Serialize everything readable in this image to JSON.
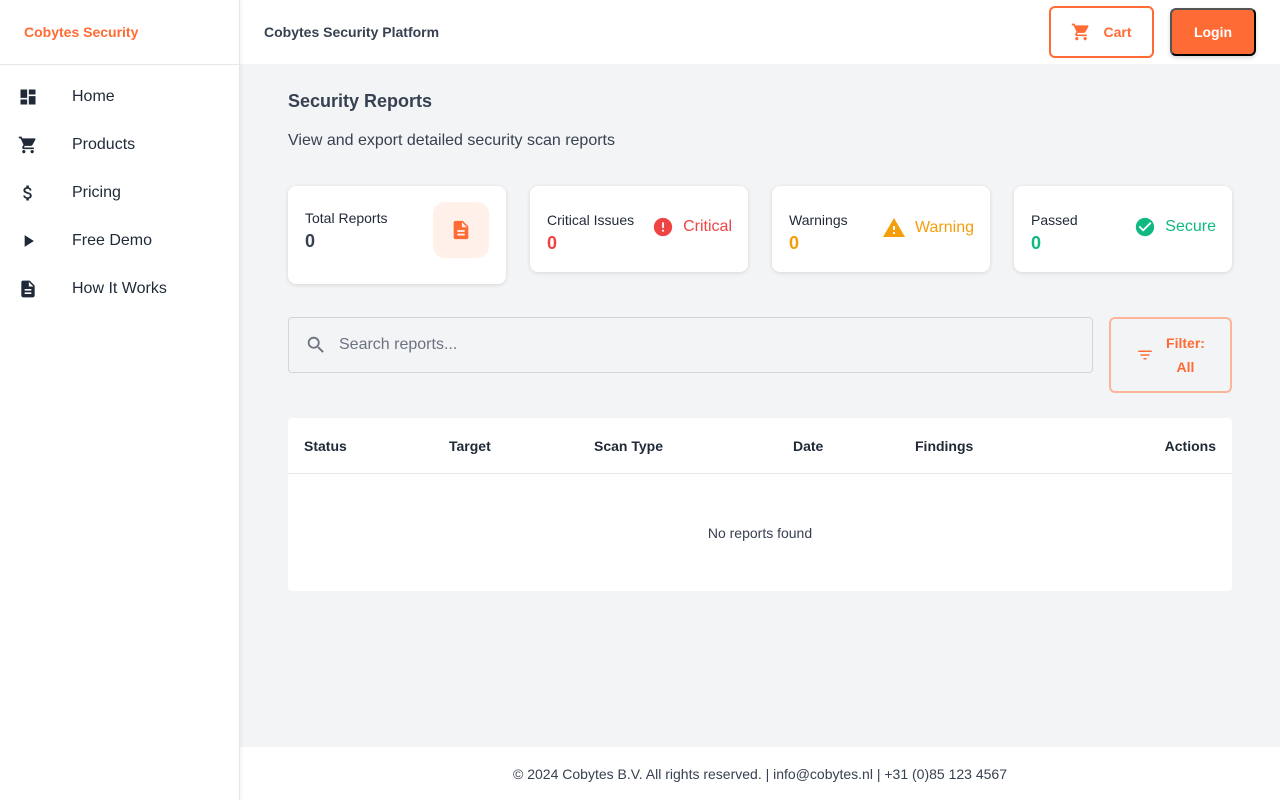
{
  "sidebar": {
    "brand": "Cobytes Security",
    "items": [
      {
        "label": "Home",
        "icon": "dashboard-icon"
      },
      {
        "label": "Products",
        "icon": "cart-icon"
      },
      {
        "label": "Pricing",
        "icon": "dollar-icon"
      },
      {
        "label": "Free Demo",
        "icon": "play-icon"
      },
      {
        "label": "How It Works",
        "icon": "document-icon"
      }
    ]
  },
  "header": {
    "title": "Cobytes Security Platform",
    "cart_label": "Cart",
    "login_label": "Login"
  },
  "main": {
    "title": "Security Reports",
    "subtitle": "View and export detailed security scan reports",
    "stats": [
      {
        "label": "Total Reports",
        "value": "0",
        "icon": "report-document-icon"
      },
      {
        "label": "Critical Issues",
        "value": "0",
        "status": "Critical",
        "icon": "error-icon",
        "color": "#ef4444"
      },
      {
        "label": "Warnings",
        "value": "0",
        "status": "Warning",
        "icon": "warning-icon",
        "color": "#f59e0b"
      },
      {
        "label": "Passed",
        "value": "0",
        "status": "Secure",
        "icon": "check-circle-icon",
        "color": "#10b981"
      }
    ],
    "search": {
      "placeholder": "Search reports...",
      "value": ""
    },
    "filter": {
      "line1": "Filter:",
      "line2": "All"
    },
    "table": {
      "columns": [
        "Status",
        "Target",
        "Scan Type",
        "Date",
        "Findings",
        "Actions"
      ],
      "empty_message": "No reports found"
    }
  },
  "footer": {
    "text": "© 2024 Cobytes B.V. All rights reserved. | info@cobytes.nl | +31 (0)85 123 4567"
  },
  "colors": {
    "accent": "#ff6b35",
    "critical": "#ef4444",
    "warning": "#f59e0b",
    "success": "#10b981"
  }
}
